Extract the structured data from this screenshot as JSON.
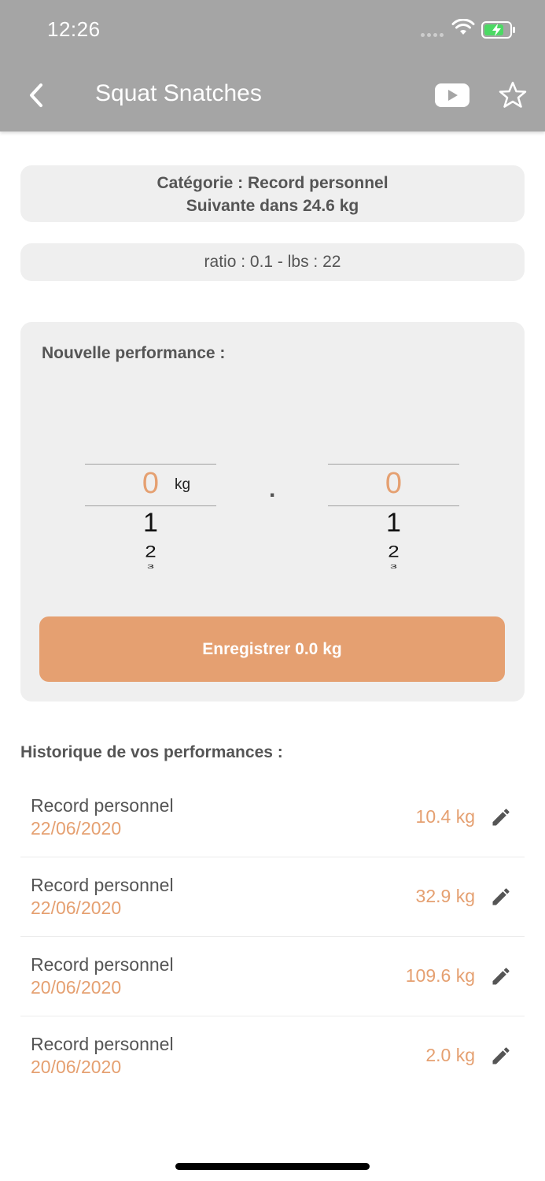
{
  "status_bar": {
    "time": "12:26"
  },
  "nav": {
    "title": "Squat Snatches",
    "back_icon": "chevron-left-icon",
    "video_icon": "youtube-icon",
    "favorite_icon": "star-outline-icon"
  },
  "category": {
    "line1": "Catégorie : Record personnel",
    "line2": "Suivante dans 24.6 kg"
  },
  "ratio": {
    "text": "ratio : 0.1 - lbs : 22"
  },
  "new_performance": {
    "title": "Nouvelle performance :",
    "integer_picker": {
      "selected": "0",
      "unit": "kg",
      "next_values": [
        "1",
        "2",
        "3"
      ]
    },
    "separator": ".",
    "decimal_picker": {
      "selected": "0",
      "next_values": [
        "1",
        "2",
        "3"
      ]
    },
    "save_label": "Enregistrer 0.0 kg"
  },
  "history": {
    "title": "Historique de vos performances :",
    "items": [
      {
        "label": "Record personnel",
        "date": "22/06/2020",
        "value": "10.4 kg"
      },
      {
        "label": "Record personnel",
        "date": "22/06/2020",
        "value": "32.9 kg"
      },
      {
        "label": "Record personnel",
        "date": "20/06/2020",
        "value": "109.6 kg"
      },
      {
        "label": "Record personnel",
        "date": "20/06/2020",
        "value": "2.0 kg"
      }
    ]
  },
  "colors": {
    "header": "#a5a5a5",
    "accent": "#e5a071",
    "card": "#efefef",
    "text": "#555555"
  }
}
